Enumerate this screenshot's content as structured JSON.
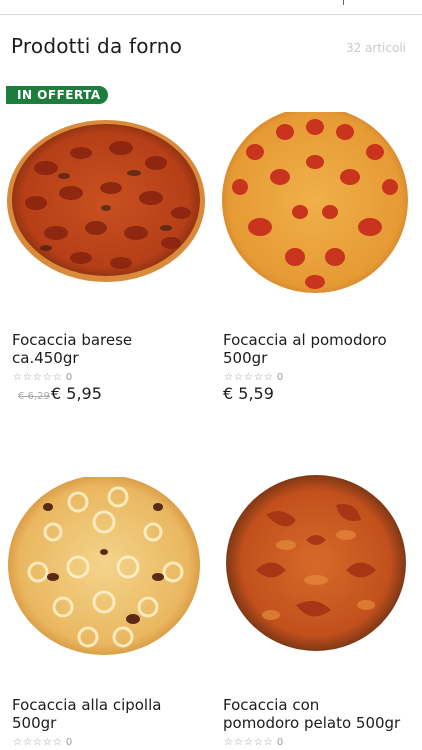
{
  "header": {
    "title": "Prodotti da forno",
    "count": "32 articoli"
  },
  "badge": "IN OFFERTA",
  "products": [
    {
      "name_line1": "Focaccia barese",
      "name_line2": "ca.450gr",
      "rating": "☆☆☆☆☆",
      "rating_count": "0",
      "old_price": "€ 6,29",
      "price": "€ 5,95",
      "icon": "focaccia-barese-image"
    },
    {
      "name_line1": "Focaccia al pomodoro",
      "name_line2": "500gr",
      "rating": "☆☆☆☆☆",
      "rating_count": "0",
      "price": "€ 5,59",
      "icon": "focaccia-pomodoro-image"
    },
    {
      "name_line1": "Focaccia alla cipolla",
      "name_line2": "500gr",
      "rating": "☆☆☆☆☆",
      "rating_count": "0",
      "icon": "focaccia-cipolla-image"
    },
    {
      "name_line1": "Focaccia con",
      "name_line2": "pomodoro pelato 500gr",
      "rating": "☆☆☆☆☆",
      "rating_count": "0",
      "icon": "focaccia-pelato-image"
    }
  ],
  "colors": {
    "badge": "#1d7d3c",
    "count": "#c9c9c9",
    "divider": "#d9d9d9"
  }
}
